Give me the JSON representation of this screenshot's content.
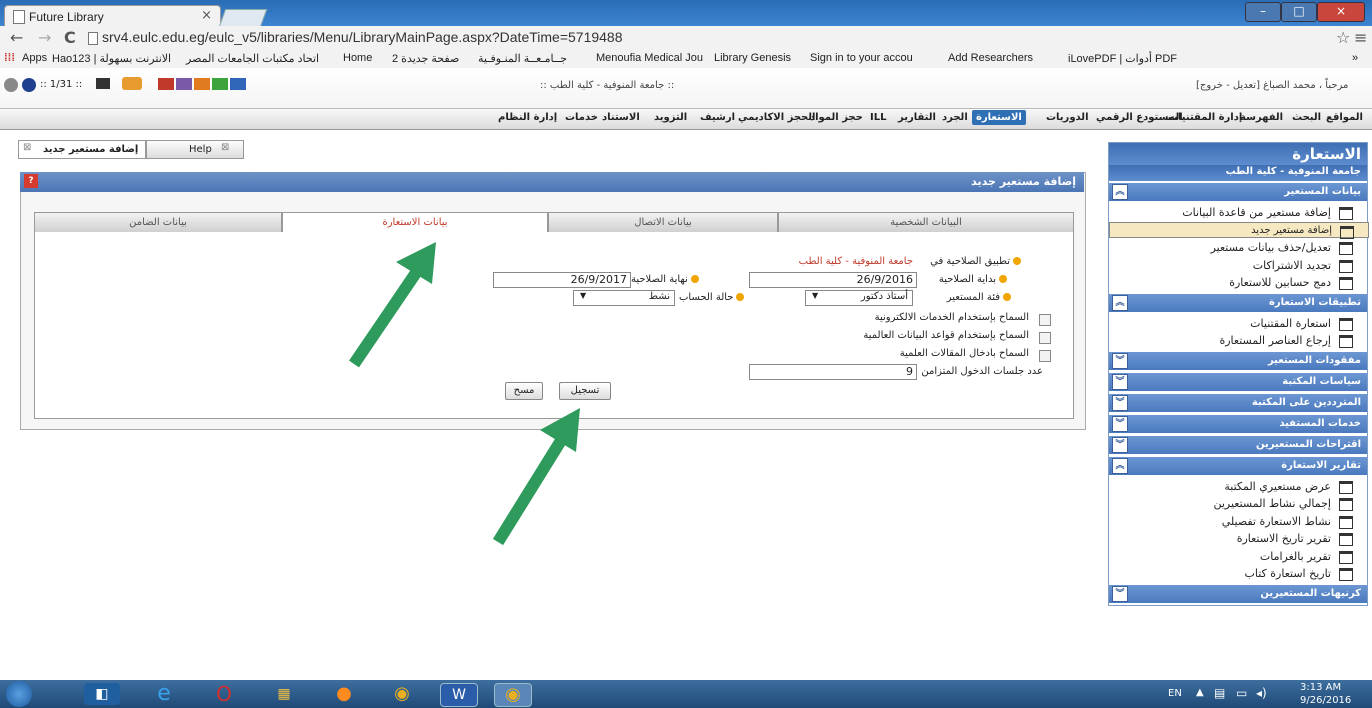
{
  "browser": {
    "tab_title": "Future Library",
    "tab_close": "×",
    "url": "srv4.eulc.edu.eg/eulc_v5/libraries/Menu/LibraryMainPage.aspx?DateTime=5719488",
    "back": "←",
    "forward": "→",
    "reload": "C",
    "star": "☆",
    "menu": "≡",
    "window_buttons": [
      "–",
      "□",
      "×"
    ],
    "bookmarks": [
      "Apps",
      "Hao123 | الانترنت بسهولة",
      "اتحاد مكتبات الجامعات المصر",
      "Home",
      "صفحة جديدة 2",
      "جــامـعــة المنـوفـية",
      "Menoufia Medical Jou",
      "Library Genesis",
      "Sign in to your accou",
      "Add Researchers",
      "iLovePDF | أدوات PDF",
      "»"
    ]
  },
  "header": {
    "user_text": "مرحباً ، محمد الصباغ [تعديل - خروج]",
    "institution": ":: جامعة المنوفية - كلية الطب ::",
    "counter": ":: 1/31 ::"
  },
  "menu": [
    "المواقع",
    "البحث",
    "الفهرسة",
    "إدارة المقتنيات",
    "المستودع الرقمي",
    "الدوريات",
    "الاستعارة",
    "الجرد",
    "التقارير",
    "ILL",
    "حجز المواد",
    "الحجز الاكاديمي",
    "ارشيف",
    "التزويد",
    "الاستناد",
    "خدمات",
    "إدارة النظام"
  ],
  "active_menu": "الاستعارة",
  "doc_tabs": [
    "إضافة مستعير جديد",
    "Help"
  ],
  "doc_tab_close": "⊠",
  "panel": {
    "title": "إضافة مستعير جديد",
    "tabs": [
      "البيانات الشخصية",
      "بيانات الاتصال",
      "بيانات الاستعارة",
      "بيانات الضامن"
    ],
    "active_tab": "بيانات الاستعارة"
  },
  "form": {
    "apply_label": "تطبيق الصلاحية في",
    "apply_value": "جامعة المنوفية - كلية الطب",
    "start_label": "بداية الصلاحية",
    "start_value": "26/9/2016",
    "end_label": "نهاية الصلاحية",
    "end_value": "26/9/2017",
    "category_label": "فئة المستعير",
    "category_value": "أستاذ دكتور",
    "status_label": "حالة الحساب",
    "status_value": "نشط",
    "check1": "السماح بإستخدام الخدمات الالكترونية",
    "check2": "السماح بإستخدام قواعد البيانات العالمية",
    "check3": "السماح بادخال المقالات العلمية",
    "sessions_label": "عدد جلسات الدخول المتزامن",
    "sessions_value": "9",
    "save_button": "تسجيل",
    "clear_button": "مسح"
  },
  "sidebar": {
    "title": "الاستعارة",
    "subtitle": "جامعة المنوفية - كلية الطب",
    "sections": [
      {
        "label": "بيانات المستعير",
        "expanded": true,
        "items": [
          "إضافة مستعير من قاعدة البيانات",
          "إضافة مستعير جديد",
          "تعديل/حذف بيانات مستعير",
          "تجديد الاشتراكات",
          "دمج حسابين للاستعارة"
        ]
      },
      {
        "label": "تطبيقات الاستعارة",
        "expanded": true,
        "items": [
          "استعارة المقتنيات",
          "إرجاع العناصر المستعارة"
        ]
      },
      {
        "label": "مفقودات المستعير",
        "expanded": false,
        "items": []
      },
      {
        "label": "سياسات المكتبة",
        "expanded": false,
        "items": []
      },
      {
        "label": "المترددين على المكتبة",
        "expanded": false,
        "items": []
      },
      {
        "label": "خدمات المستفيد",
        "expanded": false,
        "items": []
      },
      {
        "label": "اقتراحات المستعيرين",
        "expanded": false,
        "items": []
      },
      {
        "label": "تقارير الاستعارة",
        "expanded": true,
        "items": [
          "عرض مستعيري المكتبة",
          "إجمالي نشاط المستعيرين",
          "نشاط الاستعارة تفصيلي",
          "تقرير تاريخ الاستعارة",
          "تقرير بالغرامات",
          "تاريخ استعارة كتاب"
        ]
      },
      {
        "label": "كرنيهات المستعيرين",
        "expanded": false,
        "items": []
      }
    ],
    "selected_item": "إضافة مستعير جديد"
  },
  "taskbar": {
    "lang": "EN",
    "time": "3:13 AM",
    "date": "9/26/2016"
  },
  "colors": {
    "accent": "#2f6fb3",
    "sidebar_header": "#4a79be",
    "selected_row": "#f6e9c2",
    "active_tab_text": "#c0392b",
    "arrow": "#2e9a5b"
  }
}
